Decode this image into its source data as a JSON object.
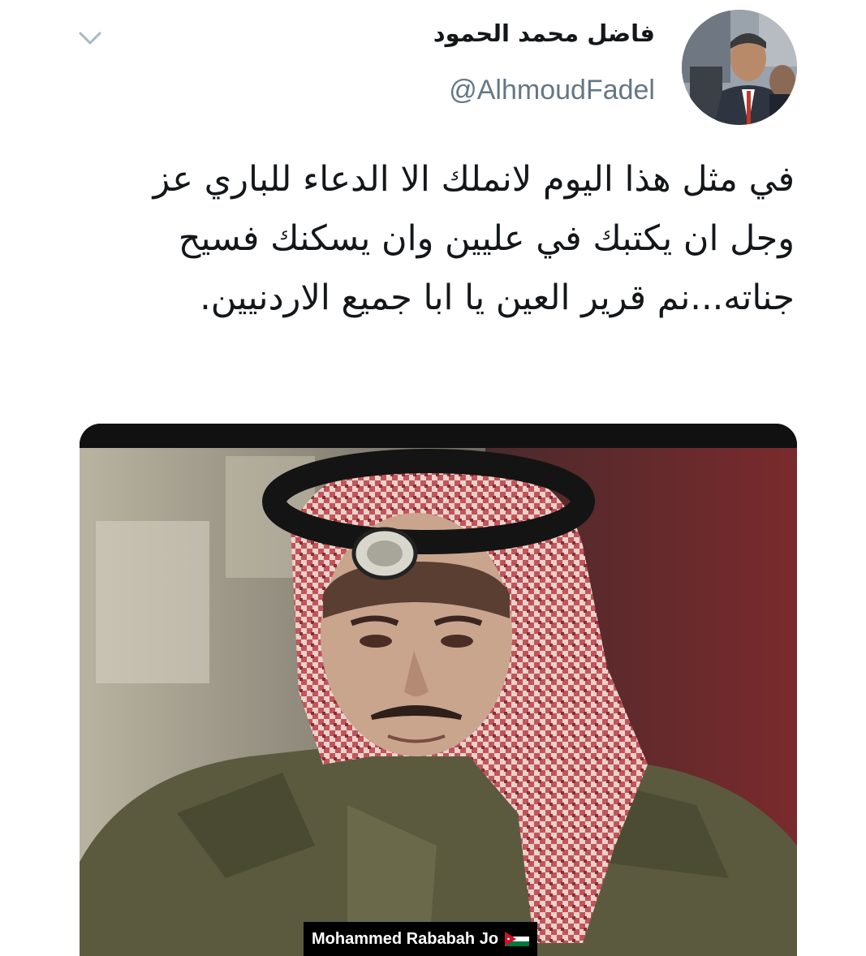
{
  "tweet": {
    "author": {
      "display_name": "فاضل محمد الحمود",
      "handle": "@AlhmoudFadel"
    },
    "text": "في مثل هذا اليوم لانملك الا الدعاء للباري عز وجل ان يكتبك في عليين وان يسكنك فسيح جناته...نم قرير العين يا ابا جميع الاردنيين.",
    "menu_icon": "chevron-down-icon",
    "media": {
      "type": "video-still",
      "watermark": "Mohammed Rababah Jo",
      "watermark_icon": "jordan-flag-icon"
    }
  },
  "colors": {
    "text_primary": "#14171a",
    "text_secondary": "#657786",
    "chevron": "#aab8c2",
    "background": "#ffffff"
  }
}
